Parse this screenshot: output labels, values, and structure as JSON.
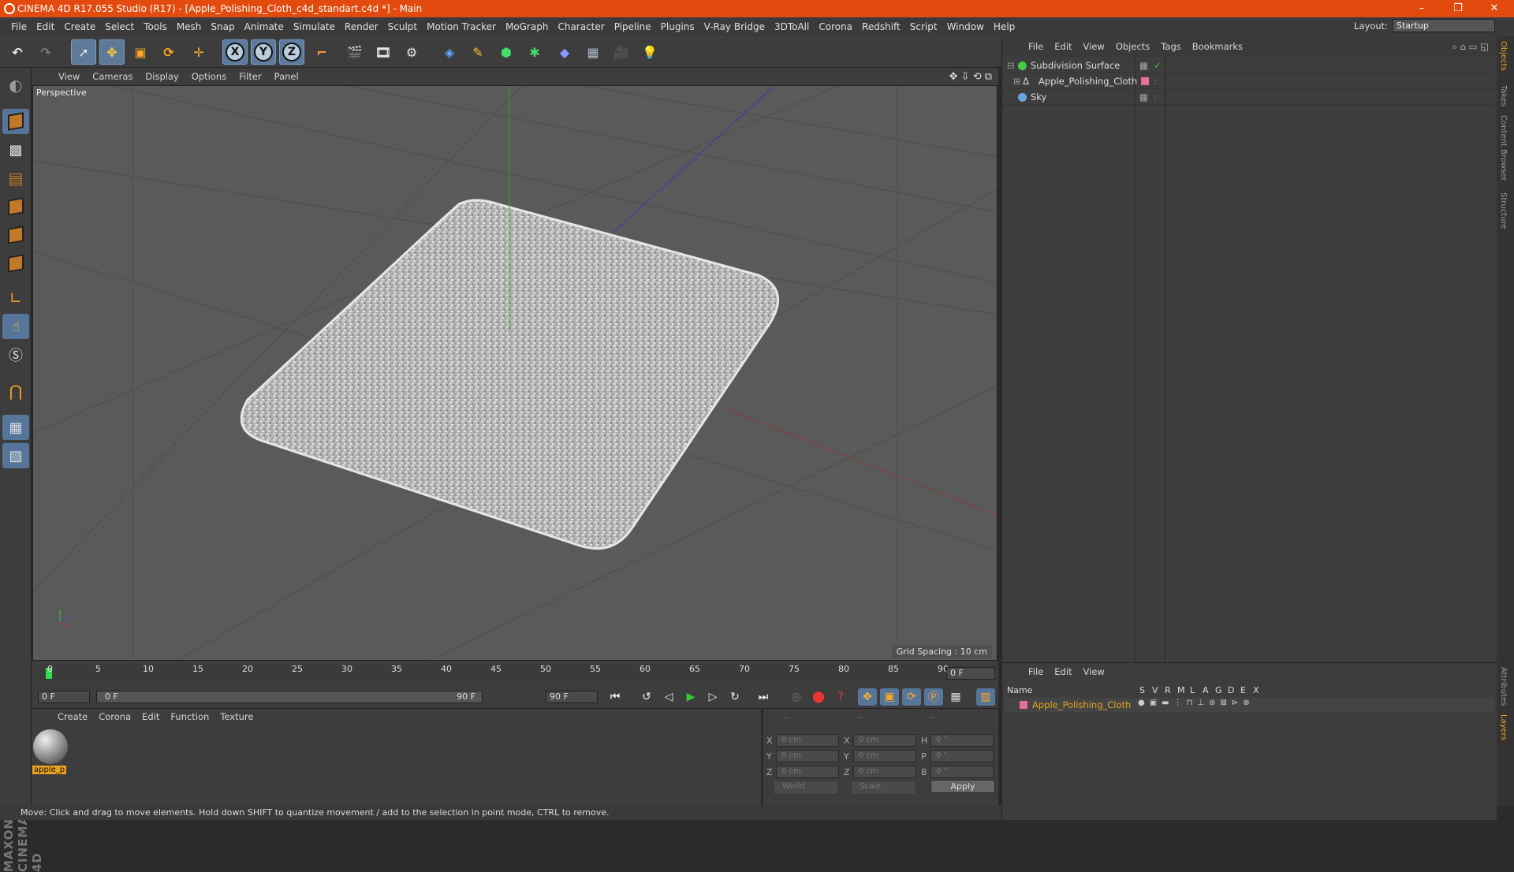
{
  "window": {
    "title": "CINEMA 4D R17.055 Studio (R17) - [Apple_Polishing_Cloth_c4d_standart.c4d *] - Main",
    "minimize": "–",
    "maximize": "❐",
    "close": "✕"
  },
  "menubar": {
    "items": [
      "File",
      "Edit",
      "Create",
      "Select",
      "Tools",
      "Mesh",
      "Snap",
      "Animate",
      "Simulate",
      "Render",
      "Sculpt",
      "Motion Tracker",
      "MoGraph",
      "Character",
      "Pipeline",
      "Plugins",
      "V-Ray Bridge",
      "3DToAll",
      "Corona",
      "Redshift",
      "Script",
      "Window",
      "Help"
    ],
    "layout_label": "Layout:",
    "layout_value": "Startup"
  },
  "toolbar": {
    "axis_x": "X",
    "axis_y": "Y",
    "axis_z": "Z"
  },
  "viewport": {
    "menu": [
      "View",
      "Cameras",
      "Display",
      "Options",
      "Filter",
      "Panel"
    ],
    "label": "Perspective",
    "grid_spacing": "Grid Spacing : 10 cm"
  },
  "timeline": {
    "ticks": [
      "0",
      "5",
      "10",
      "15",
      "20",
      "25",
      "30",
      "35",
      "40",
      "45",
      "50",
      "55",
      "60",
      "65",
      "70",
      "75",
      "80",
      "85",
      "90"
    ],
    "current_frame": "0 F",
    "start_field": "0 F",
    "range_start": "0 F",
    "range_end": "90 F",
    "end_field": "90 F"
  },
  "materials": {
    "menu": [
      "Create",
      "Corona",
      "Edit",
      "Function",
      "Texture"
    ],
    "items": [
      {
        "name": "apple_p"
      }
    ]
  },
  "coordinates": {
    "headers": [
      "--",
      "--",
      "--"
    ],
    "rows": [
      {
        "l1": "X",
        "v1": "0 cm",
        "l2": "X",
        "v2": "0 cm",
        "l3": "H",
        "v3": "0 °"
      },
      {
        "l1": "Y",
        "v1": "0 cm",
        "l2": "Y",
        "v2": "0 cm",
        "l3": "P",
        "v3": "0 °"
      },
      {
        "l1": "Z",
        "v1": "0 cm",
        "l2": "Z",
        "v2": "0 cm",
        "l3": "B",
        "v3": "0 °"
      }
    ],
    "mode_world": "World",
    "mode_scale": "Scale",
    "apply": "Apply"
  },
  "objects": {
    "menu": [
      "File",
      "Edit",
      "View",
      "Objects",
      "Tags",
      "Bookmarks"
    ],
    "items": [
      {
        "name": "Subdivision Surface"
      },
      {
        "name": "Apple_Polishing_Cloth"
      },
      {
        "name": "Sky"
      }
    ]
  },
  "right_tabs": [
    "Objects",
    "Takes",
    "Content Browser",
    "Structure"
  ],
  "right_tabs_bottom": [
    "Attributes",
    "Layers"
  ],
  "layers": {
    "menu": [
      "File",
      "Edit",
      "View"
    ],
    "headers": [
      "Name",
      "S",
      "V",
      "R",
      "M",
      "L",
      "A",
      "G",
      "D",
      "E",
      "X"
    ],
    "row_name": "Apple_Polishing_Cloth"
  },
  "brand": "MAXON CINEMA 4D",
  "status": "Move: Click and drag to move elements. Hold down SHIFT to quantize movement / add to the selection in point mode, CTRL to remove.",
  "colors": {
    "titlebar": "#e24a0e",
    "layer_color": "#e86f9a",
    "material_label": "#e8a21f",
    "playhead": "#2edf4d"
  }
}
